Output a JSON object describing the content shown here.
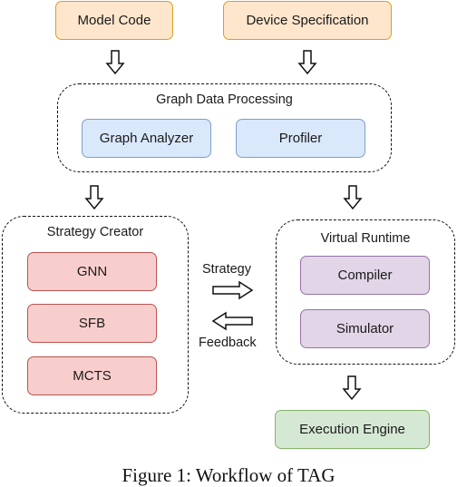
{
  "inputs": {
    "model_code": "Model Code",
    "device_specification": "Device Specification"
  },
  "graph_data_processing": {
    "title": "Graph Data Processing",
    "graph_analyzer": "Graph Analyzer",
    "profiler": "Profiler"
  },
  "strategy_creator": {
    "title": "Strategy Creator",
    "items": [
      "GNN",
      "SFB",
      "MCTS"
    ]
  },
  "virtual_runtime": {
    "title": "Virtual Runtime",
    "compiler": "Compiler",
    "simulator": "Simulator"
  },
  "edges": {
    "strategy": "Strategy",
    "feedback": "Feedback"
  },
  "execution_engine": "Execution Engine",
  "caption": "Figure 1: Workflow of TAG",
  "colors": {
    "orange_fill": "#fde6cc",
    "orange_stroke": "#d6a026",
    "blue_fill": "#dae8fc",
    "blue_stroke": "#7f9fc6",
    "red_fill": "#f8cecc",
    "red_stroke": "#b85450",
    "purple_fill": "#e1d5e7",
    "purple_stroke": "#9673a6",
    "green_fill": "#d5e8d4",
    "green_stroke": "#82b366"
  }
}
